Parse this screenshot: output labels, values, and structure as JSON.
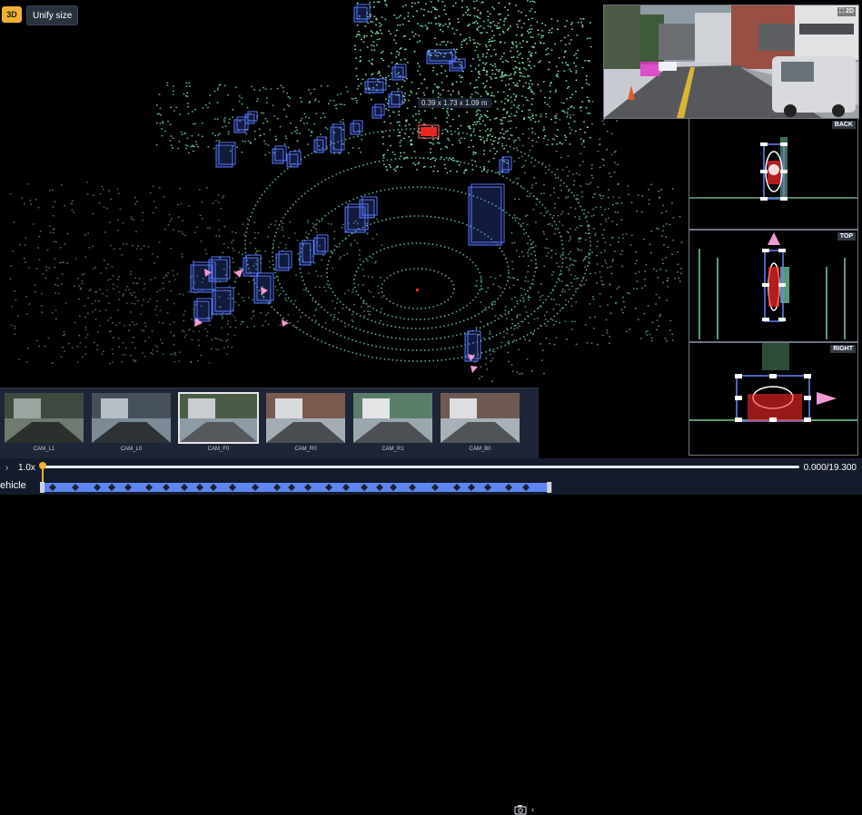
{
  "toolbar": {
    "mode_badge": "3D",
    "unify_size_label": "Unify size"
  },
  "selection": {
    "dimensions": "0.39 x 1.73 x 1.09 m"
  },
  "camera_view": {
    "tag": "2D"
  },
  "side_views": [
    {
      "tag": "BACK"
    },
    {
      "tag": "TOP"
    },
    {
      "tag": "RIGHT"
    }
  ],
  "cameras": [
    {
      "label": "CAM_L1",
      "selected": false
    },
    {
      "label": "CAM_L0",
      "selected": false
    },
    {
      "label": "CAM_F0",
      "selected": true
    },
    {
      "label": "CAM_R0",
      "selected": false
    },
    {
      "label": "CAM_R1",
      "selected": false
    },
    {
      "label": "CAM_B0",
      "selected": false
    }
  ],
  "timeline": {
    "speed": "1.0x",
    "time_readout": "0.000/19.300",
    "current_time": 0.0,
    "duration": 19.3,
    "track_label": "ehicle",
    "track_end_time": 13.05
  },
  "colors": {
    "accent": "#f2b035",
    "points": "#7fd9a6",
    "box": "#4a6cf0",
    "selected_point": "#ff2a2a",
    "track_bar": "#5e86f2"
  }
}
